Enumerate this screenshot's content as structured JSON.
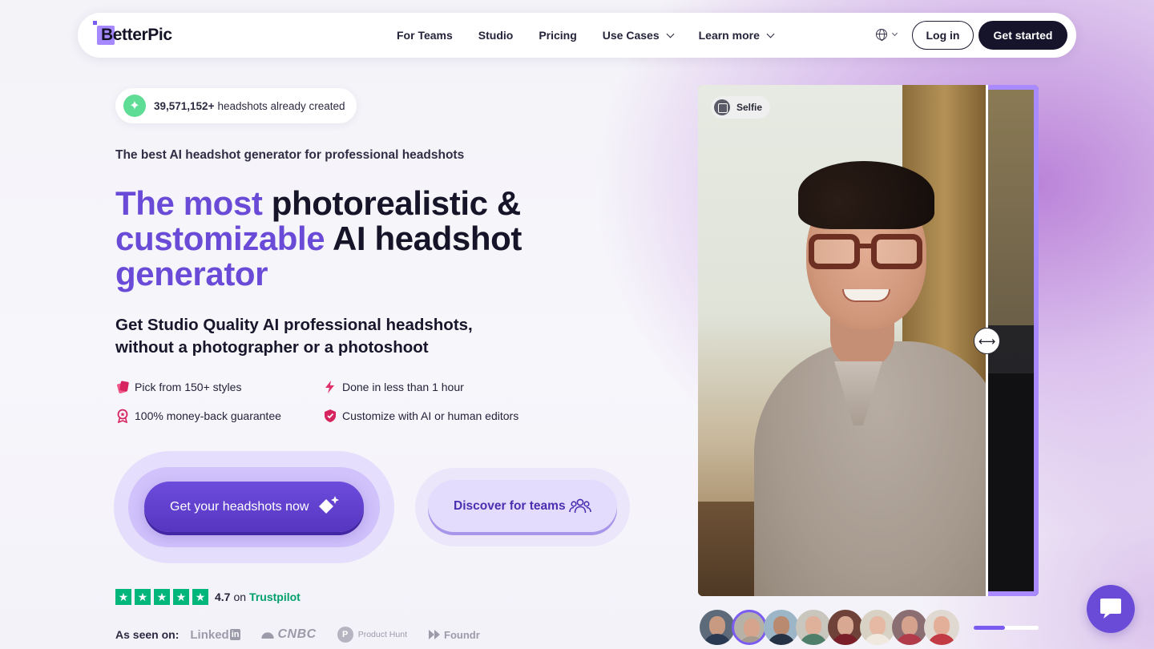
{
  "nav": {
    "logo": "BetterPic",
    "links": [
      {
        "label": "For Teams"
      },
      {
        "label": "Studio"
      },
      {
        "label": "Pricing"
      },
      {
        "label": "Use Cases"
      },
      {
        "label": "Learn more"
      }
    ],
    "login_label": "Log in",
    "cta_label": "Get started"
  },
  "hero": {
    "counter_number": "39,571,152+",
    "counter_text": "headshots already created",
    "eyebrow": "The best AI headshot generator for professional headshots",
    "headline_grad_1": "The most ",
    "headline_dark_1": "photorealistic &",
    "headline_grad_2": "customizable ",
    "headline_dark_2": "AI headshot",
    "headline_grad_3": "generator",
    "sub_line_1": "Get Studio Quality AI professional headshots,",
    "sub_line_2": "without a photographer or a photoshoot",
    "features": [
      {
        "label": "Pick from 150+ styles",
        "icon": "styles-icon"
      },
      {
        "label": "Done in less than 1 hour",
        "icon": "lightning-icon"
      },
      {
        "label": "100% money-back guarantee",
        "icon": "award-icon"
      },
      {
        "label": "Customize with AI or human editors",
        "icon": "shield-icon"
      }
    ],
    "primary_cta": "Get your headshots now",
    "secondary_cta": "Discover for teams",
    "rating": {
      "score": "4.7",
      "on": "on",
      "platform": "Trustpilot",
      "stars": 5
    },
    "seen_on": {
      "label": "As seen on:",
      "brands": [
        "Linked",
        "in",
        "CNBC",
        "P",
        "Product Hunt",
        "Foundr"
      ]
    }
  },
  "comparison": {
    "badge": "Selfie",
    "slider_position_pct": 84.5
  },
  "gallery": {
    "thumb_count": 8,
    "active_index": 1,
    "progress_fraction": 0.48
  },
  "colors": {
    "accent": "#6a4bd8",
    "dark": "#15142a",
    "trustpilot": "#00b67a"
  }
}
